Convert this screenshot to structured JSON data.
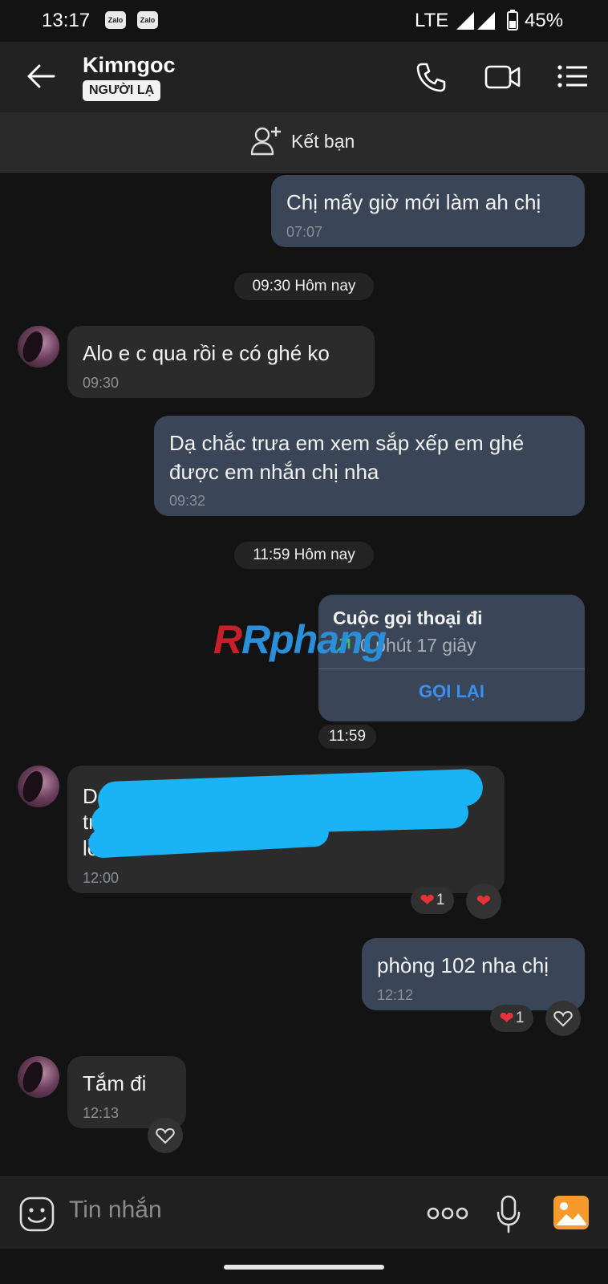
{
  "status_bar": {
    "time": "13:17",
    "app_icons": [
      "Zalo",
      "Zalo"
    ],
    "network": "LTE",
    "battery": "45%"
  },
  "header": {
    "contact_name": "Kimngoc",
    "badge": "NGƯỜI LẠ",
    "icons": [
      "back-arrow-icon",
      "phone-icon",
      "video-call-icon",
      "menu-list-icon"
    ]
  },
  "add_friend": {
    "label": "Kết bạn"
  },
  "messages": [
    {
      "id": "m1",
      "direction": "out",
      "text": "Chị mấy giờ mới làm ah chị",
      "time": "07:07"
    },
    {
      "id": "d1",
      "type": "divider",
      "text": "09:30 Hôm nay"
    },
    {
      "id": "m2",
      "direction": "in",
      "text": "Alo e c qua rồi e có ghé ko",
      "time": "09:30"
    },
    {
      "id": "m3",
      "direction": "out",
      "text_lines": [
        "Dạ chắc trưa em xem sắp xếp em ghé",
        "được em nhắn chị nha"
      ],
      "time": "09:32"
    },
    {
      "id": "d2",
      "type": "divider",
      "text": "11:59 Hôm nay"
    },
    {
      "id": "call",
      "direction": "out",
      "type": "call",
      "title": "Cuộc gọi thoại đi",
      "duration": "0 phút 17 giây",
      "action": "GỌI LẠI",
      "time": "11:59"
    },
    {
      "id": "m4",
      "direction": "in",
      "redacted": true,
      "visible_fragments": [
        "D",
        "tru",
        "lề"
      ],
      "time": "12:00",
      "reaction_count": "1"
    },
    {
      "id": "m5",
      "direction": "out",
      "text": "phòng 102 nha chị",
      "time": "12:12",
      "reaction_count": "1"
    },
    {
      "id": "m6",
      "direction": "in",
      "text": "Tắm đi",
      "time": "12:13"
    }
  ],
  "watermark": "Rphang",
  "input": {
    "placeholder": "Tin nhắn",
    "icons": [
      "emoji-icon",
      "more-options-icon",
      "microphone-icon",
      "image-icon"
    ]
  },
  "colors": {
    "background": "#131313",
    "outgoing_bubble": "#3a4557",
    "incoming_bubble": "#2b2b2b",
    "accent": "#3a8ff5",
    "heart": "#e8323a"
  }
}
